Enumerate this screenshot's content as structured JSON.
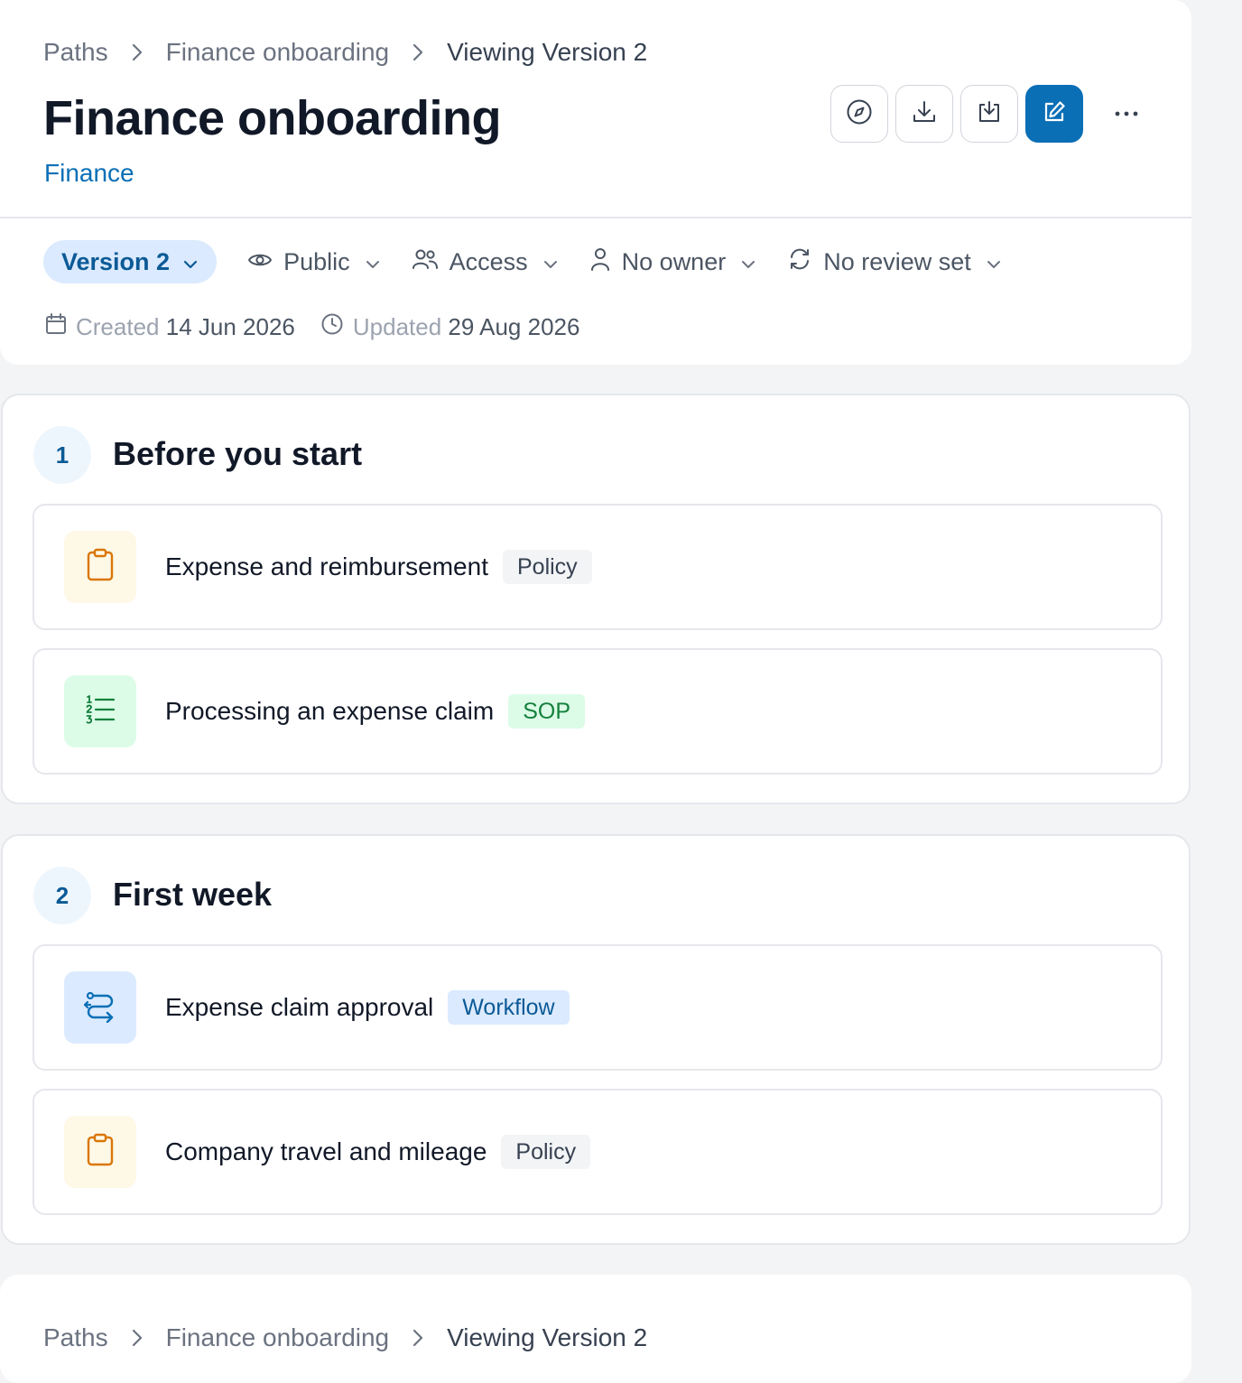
{
  "breadcrumb": [
    {
      "label": "Paths"
    },
    {
      "label": "Finance onboarding"
    },
    {
      "label": "Viewing Version 2"
    }
  ],
  "page": {
    "title": "Finance onboarding",
    "category": "Finance"
  },
  "toolbar": {
    "version": "Version 2",
    "visibility": "Public",
    "access": "Access",
    "owner": "No owner",
    "review": "No review set"
  },
  "dates": {
    "created_label": "Created",
    "created_value": "14 Jun 2026",
    "updated_label": "Updated",
    "updated_value": "29 Aug 2026"
  },
  "sections": [
    {
      "number": "1",
      "title": "Before you start",
      "items": [
        {
          "title": "Expense and reimbursement",
          "tag": "Policy",
          "icon": "clipboard-icon"
        },
        {
          "title": "Processing an expense claim",
          "tag": "SOP",
          "icon": "numbered-list-icon"
        }
      ]
    },
    {
      "number": "2",
      "title": "First week",
      "items": [
        {
          "title": "Expense claim approval",
          "tag": "Workflow",
          "icon": "workflow-arrows-icon"
        },
        {
          "title": "Company travel and mileage",
          "tag": "Policy",
          "icon": "clipboard-icon"
        }
      ]
    }
  ],
  "colors": {
    "accent": "#0b6fb6",
    "policy_bg": "#fef8e7",
    "policy_icon": "#d97706",
    "sop_bg": "#dcfce7",
    "sop_icon": "#15803d",
    "workflow_bg": "#dbeafe",
    "workflow_icon": "#0b6fb6"
  }
}
